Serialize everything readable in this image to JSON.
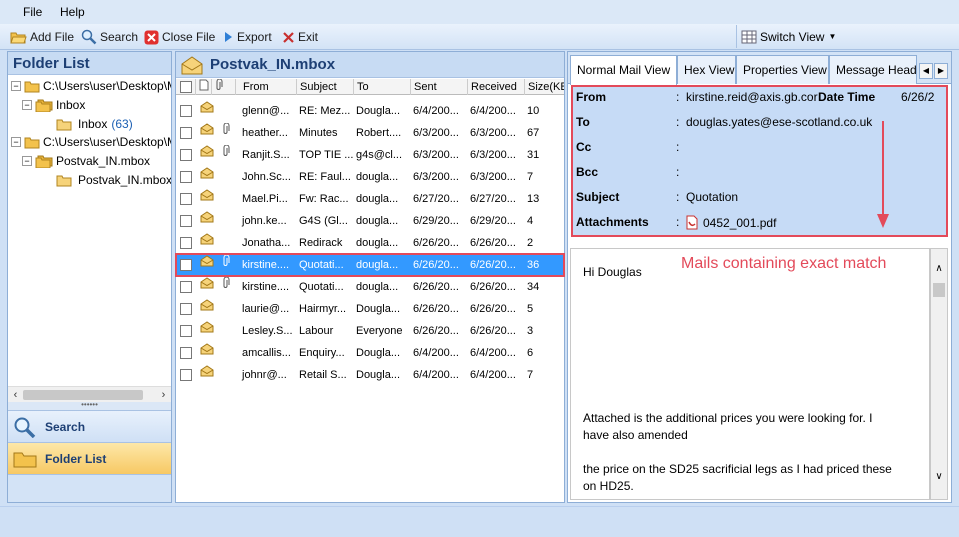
{
  "menu": {
    "file": "File",
    "help": "Help"
  },
  "toolbar": {
    "add_file": "Add File",
    "search": "Search",
    "close_file": "Close File",
    "export": "Export",
    "exit": "Exit",
    "switch_view": "Switch View"
  },
  "folder_pane": {
    "title": "Folder List",
    "tree": [
      {
        "label": "C:\\Users\\user\\Desktop\\Mi"
      },
      {
        "label": "Inbox"
      },
      {
        "label": "Inbox",
        "count": "(63)"
      },
      {
        "label": "C:\\Users\\user\\Desktop\\Mi"
      },
      {
        "label": "Postvak_IN.mbox"
      },
      {
        "label": "Postvak_IN.mbox"
      }
    ],
    "nav": {
      "search": "Search",
      "folder_list": "Folder List"
    }
  },
  "list_pane": {
    "title": "Postvak_IN.mbox",
    "columns": {
      "from": "From",
      "subject": "Subject",
      "to": "To",
      "sent": "Sent",
      "received": "Received",
      "size": "Size(KE"
    },
    "rows": [
      {
        "from": "glenn@...",
        "subject": "RE: Mez...",
        "to": "Dougla...",
        "sent": "6/4/200...",
        "received": "6/4/200...",
        "size": "10",
        "attach": false
      },
      {
        "from": "heather...",
        "subject": "Minutes",
        "to": "Robert....",
        "sent": "6/3/200...",
        "received": "6/3/200...",
        "size": "67",
        "attach": true
      },
      {
        "from": "Ranjit.S...",
        "subject": "TOP TIE ...",
        "to": "g4s@cl...",
        "sent": "6/3/200...",
        "received": "6/3/200...",
        "size": "31",
        "attach": true
      },
      {
        "from": "John.Sc...",
        "subject": "RE: Faul...",
        "to": "dougla...",
        "sent": "6/3/200...",
        "received": "6/3/200...",
        "size": "7",
        "attach": false
      },
      {
        "from": "Mael.Pi...",
        "subject": "Fw: Rac...",
        "to": "dougla...",
        "sent": "6/27/20...",
        "received": "6/27/20...",
        "size": "13",
        "attach": false
      },
      {
        "from": "john.ke...",
        "subject": "G4S (Gl...",
        "to": "dougla...",
        "sent": "6/29/20...",
        "received": "6/29/20...",
        "size": "4",
        "attach": false
      },
      {
        "from": "Jonatha...",
        "subject": "Redirack",
        "to": "dougla...",
        "sent": "6/26/20...",
        "received": "6/26/20...",
        "size": "2",
        "attach": false
      },
      {
        "from": "kirstine....",
        "subject": "Quotati...",
        "to": "dougla...",
        "sent": "6/26/20...",
        "received": "6/26/20...",
        "size": "36",
        "attach": true
      },
      {
        "from": "kirstine....",
        "subject": "Quotati...",
        "to": "dougla...",
        "sent": "6/26/20...",
        "received": "6/26/20...",
        "size": "34",
        "attach": true
      },
      {
        "from": "laurie@...",
        "subject": "Hairmyr...",
        "to": "Dougla...",
        "sent": "6/26/20...",
        "received": "6/26/20...",
        "size": "5",
        "attach": false
      },
      {
        "from": "Lesley.S...",
        "subject": "Labour",
        "to": "Everyone",
        "sent": "6/26/20...",
        "received": "6/26/20...",
        "size": "3",
        "attach": false
      },
      {
        "from": "amcallis...",
        "subject": "Enquiry...",
        "to": "Dougla...",
        "sent": "6/4/200...",
        "received": "6/4/200...",
        "size": "6",
        "attach": false
      },
      {
        "from": "johnr@...",
        "subject": "Retail S...",
        "to": "Dougla...",
        "sent": "6/4/200...",
        "received": "6/4/200...",
        "size": "7",
        "attach": false
      }
    ]
  },
  "preview": {
    "tabs": [
      "Normal Mail View",
      "Hex View",
      "Properties View",
      "Message Heade"
    ],
    "header": {
      "from_label": "From",
      "from": "kirstine.reid@axis.gb.cor",
      "datetime_label": "Date Time",
      "datetime": "6/26/2",
      "to_label": "To",
      "to": "douglas.yates@ese-scotland.co.uk",
      "cc_label": "Cc",
      "cc": "",
      "bcc_label": "Bcc",
      "bcc": "",
      "subject_label": "Subject",
      "subject": "Quotation",
      "attachments_label": "Attachments",
      "attachment": "0452_001.pdf"
    },
    "body": {
      "greeting": "Hi Douglas",
      "line1": "Attached is the additional prices  you were looking for.  I",
      "line2": "have also amended",
      "line3": "the price on the SD25 sacrificial legs as I had priced these",
      "line4": "on HD25."
    },
    "annotation": "Mails containing exact match"
  },
  "colors": {
    "accent": "#e34a5a",
    "selection": "#3399ff",
    "header_bg": "#c6dbf6"
  }
}
